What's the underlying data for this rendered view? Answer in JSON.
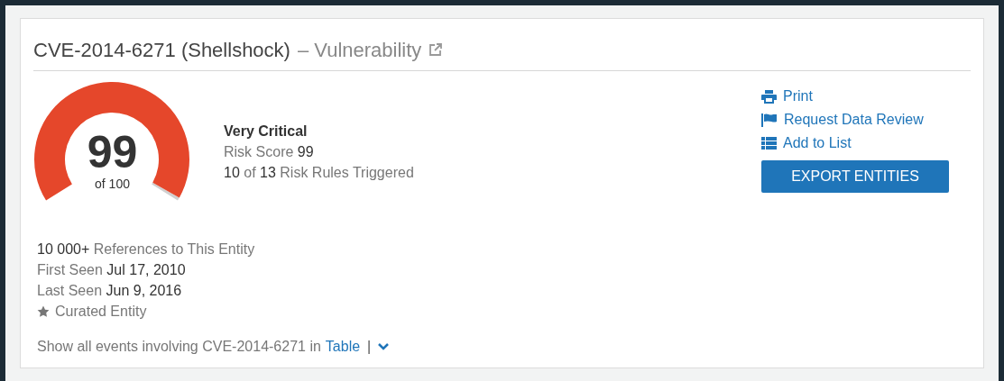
{
  "header": {
    "title": "CVE-2014-6271 (Shellshock)",
    "type": "– Vulnerability"
  },
  "gauge": {
    "score": "99",
    "caption": "of 100"
  },
  "risk": {
    "severity": "Very Critical",
    "lines": [
      [
        {
          "text": "Risk Score ",
          "dark": false
        },
        {
          "text": "99",
          "dark": true
        }
      ],
      [
        {
          "text": "10",
          "dark": true
        },
        {
          "text": " of ",
          "dark": false
        },
        {
          "text": "13",
          "dark": true
        },
        {
          "text": " Risk Rules Triggered",
          "dark": false
        }
      ]
    ]
  },
  "actions": [
    {
      "kind": "print",
      "label": "Print"
    },
    {
      "kind": "flag",
      "label": "Request Data Review"
    },
    {
      "kind": "list",
      "label": "Add to List"
    }
  ],
  "export_button": "EXPORT ENTITIES",
  "details": [
    [
      {
        "text": "10 000+",
        "dark": true
      },
      {
        "text": " References to This Entity",
        "dark": false
      }
    ],
    [
      {
        "text": "First Seen ",
        "dark": false
      },
      {
        "text": "Jul 17, 2010",
        "dark": true
      }
    ],
    [
      {
        "text": "Last Seen ",
        "dark": false
      },
      {
        "text": "Jun 9, 2016",
        "dark": true
      }
    ]
  ],
  "curated": {
    "label": "Curated Entity"
  },
  "footer": {
    "text": "Show all events involving CVE-2014-6271 in",
    "link": "Table",
    "separator": "|"
  }
}
